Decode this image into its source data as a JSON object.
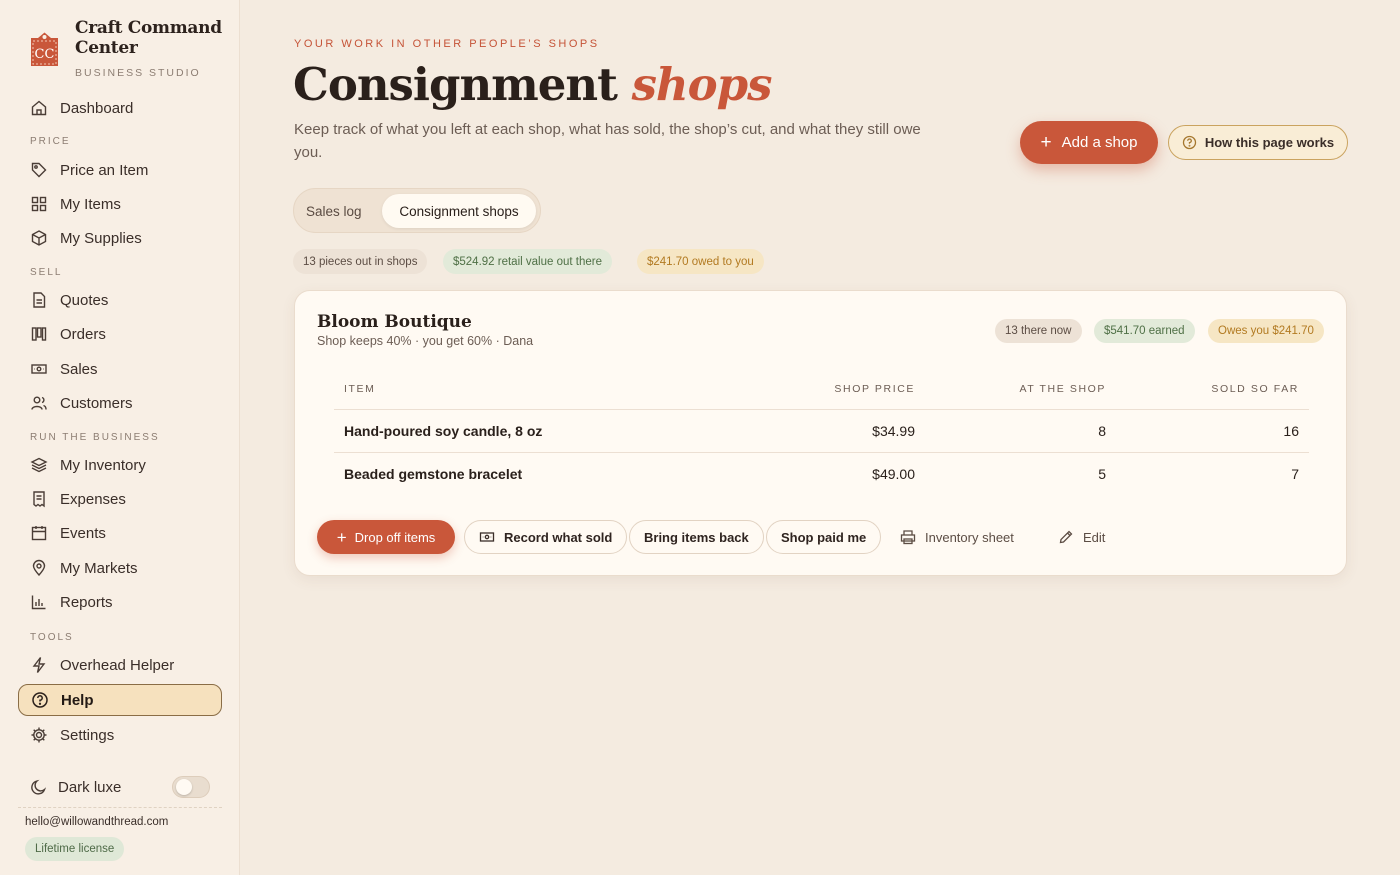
{
  "brand": {
    "logo_text": "CC",
    "name": "Craft Command Center",
    "subtitle": "BUSINESS STUDIO"
  },
  "sidebar": {
    "dashboard": "Dashboard",
    "sections": {
      "price": "PRICE",
      "sell": "SELL",
      "run": "RUN THE BUSINESS",
      "tools": "TOOLS"
    },
    "items": {
      "price_an_item": "Price an Item",
      "my_items": "My Items",
      "my_supplies": "My Supplies",
      "quotes": "Quotes",
      "orders": "Orders",
      "sales": "Sales",
      "customers": "Customers",
      "my_inventory": "My Inventory",
      "expenses": "Expenses",
      "events": "Events",
      "my_markets": "My Markets",
      "reports": "Reports",
      "overhead_helper": "Overhead Helper",
      "help": "Help",
      "settings": "Settings"
    },
    "active_item": "help",
    "dark_mode_label": "Dark luxe",
    "dark_mode_on": false,
    "email": "hello@willowandthread.com",
    "license": "Lifetime license"
  },
  "header": {
    "eyebrow": "YOUR WORK IN OTHER PEOPLE’S SHOPS",
    "title_main": "Consignment",
    "title_accent": "shops",
    "subtitle": "Keep track of what you left at each shop, what has sold, the shop’s cut, and what they still owe you.",
    "add_button": "Add a shop",
    "how_button": "How this page works"
  },
  "tabs": [
    {
      "label": "Sales log",
      "active": false
    },
    {
      "label": "Consignment shops",
      "active": true
    }
  ],
  "summary": {
    "pieces": "13 pieces out in shops",
    "retail": "$524.92 retail value out there",
    "owed": "$241.70 owed to you"
  },
  "shop": {
    "name": "Bloom Boutique",
    "terms": "Shop keeps 40% · you get 60% · Dana",
    "badges": {
      "there_now": "13 there now",
      "earned": "$541.70 earned",
      "owes": "Owes you $241.70"
    },
    "columns": [
      "ITEM",
      "SHOP PRICE",
      "AT THE SHOP",
      "SOLD SO FAR"
    ],
    "rows": [
      {
        "item": "Hand-poured soy candle, 8 oz",
        "price": "$34.99",
        "at_shop": "8",
        "sold": "16"
      },
      {
        "item": "Beaded gemstone bracelet",
        "price": "$49.00",
        "at_shop": "5",
        "sold": "7"
      }
    ],
    "actions": {
      "drop_off": "Drop off items",
      "record_sold": "Record what sold",
      "bring_back": "Bring items back",
      "paid": "Shop paid me",
      "inventory_sheet": "Inventory sheet",
      "edit": "Edit"
    }
  },
  "colors": {
    "accent": "#c9573a",
    "background": "#f4ebe0",
    "card": "#fffaf3",
    "active_nav": "#f6e1be"
  }
}
